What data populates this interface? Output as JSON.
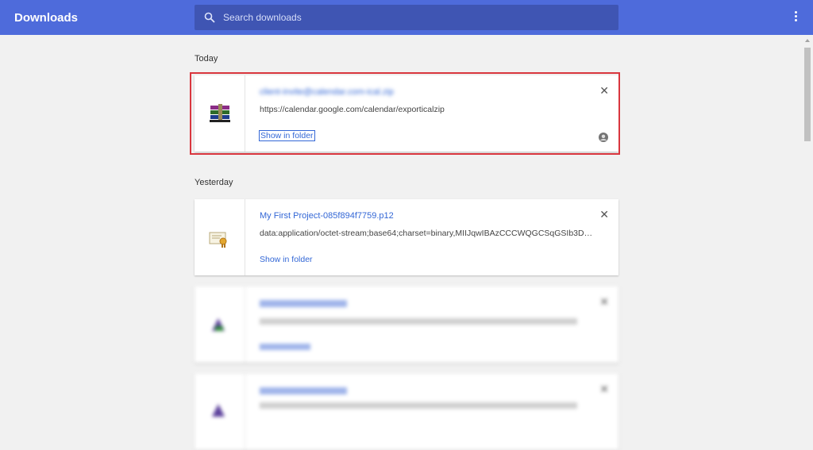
{
  "header": {
    "title": "Downloads",
    "search_placeholder": "Search downloads",
    "search_value": "",
    "menu_icon": "more-vert-icon",
    "accent_color": "#4e6bdb"
  },
  "sections": {
    "today": "Today",
    "yesterday": "Yesterday"
  },
  "downloads": [
    {
      "name": "",
      "url": "https://calendar.google.com/calendar/exporticalzip",
      "action": "Show in folder",
      "icon": "winrar-archive-icon",
      "blurred_name": true
    },
    {
      "name": "My First Project-085f894f7759.p12",
      "url": "data:application/octet-stream;base64;charset=binary,MIIJqwIBAzCCCWQGCSqGSIb3DQ...",
      "action": "Show in folder",
      "icon": "certificate-icon"
    },
    {
      "name": "",
      "url": "",
      "action": "",
      "icon": "installer-icon",
      "blurred": true
    },
    {
      "name": "",
      "url": "",
      "action": "",
      "icon": "installer-icon",
      "blurred": true
    }
  ]
}
